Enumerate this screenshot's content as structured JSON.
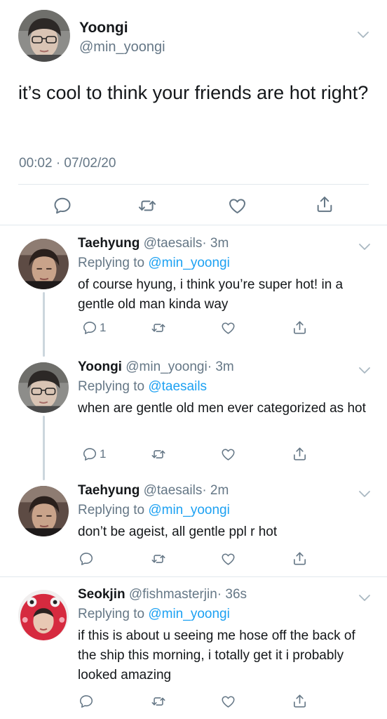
{
  "main_tweet": {
    "author_name": "Yoongi",
    "author_handle": "@min_yoongi",
    "text": "it’s cool to think your friends are hot right?",
    "timestamp": "00:02 · 07/02/20",
    "avatar": "avatar-photo-yoongi",
    "menu_icon": "chevron-down-icon"
  },
  "replies": [
    {
      "author_name": "Taehyung",
      "author_handle": "@taesails",
      "age": "· 3m",
      "replying_prefix": "Replying to",
      "replying_to": "@min_yoongi",
      "text": "of course hyung, i think you’re super hot! in a gentle old man kinda way",
      "reply_count": "1",
      "avatar": "avatar-photo-taehyung"
    },
    {
      "author_name": "Yoongi",
      "author_handle": "@min_yoongi",
      "age": "· 3m",
      "replying_prefix": "Replying to",
      "replying_to": "@taesails",
      "text": "when are gentle old men ever categorized as hot",
      "reply_count": "1",
      "avatar": "avatar-photo-yoongi"
    },
    {
      "author_name": "Taehyung",
      "author_handle": "@taesails",
      "age": "· 2m",
      "replying_prefix": "Replying to",
      "replying_to": "@min_yoongi",
      "text": "don’t be ageist, all gentle ppl r hot",
      "reply_count": "",
      "avatar": "avatar-photo-taehyung"
    },
    {
      "author_name": "Seokjin",
      "author_handle": "@fishmasterjin",
      "age": "· 36s",
      "replying_prefix": "Replying to",
      "replying_to": "@min_yoongi",
      "text": "if this is about u seeing me hose off the back of the ship this morning, i totally get it i probably looked amazing",
      "reply_count": "",
      "avatar": "avatar-photo-seokjin"
    }
  ],
  "icons": [
    "reply-icon",
    "retweet-icon",
    "like-icon",
    "share-icon",
    "chevron-down-icon"
  ],
  "colors": {
    "link": "#1da1f2",
    "secondary_text": "#657786",
    "divider": "#e1e8ed",
    "thread_line": "#ccd6dd"
  }
}
